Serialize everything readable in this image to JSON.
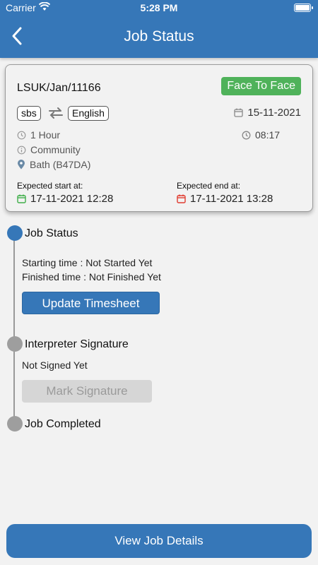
{
  "status_bar": {
    "carrier": "Carrier",
    "time": "5:28 PM"
  },
  "header": {
    "title": "Job Status"
  },
  "job": {
    "id": "LSUK/Jan/11166",
    "type_badge": "Face To Face",
    "source_language": "sbs",
    "target_language": "English",
    "date": "15-11-2021",
    "duration": "1 Hour",
    "time": "08:17",
    "category": "Community",
    "location": "Bath (B47DA)",
    "expected_start_label": "Expected start at:",
    "expected_start": "17-11-2021 12:28",
    "expected_end_label": "Expected end at:",
    "expected_end": "17-11-2021 13:28"
  },
  "timeline": {
    "step1_title": "Job Status",
    "starting_time": "Starting time : Not Started Yet",
    "finished_time": "Finished time : Not Finished Yet",
    "update_button": "Update Timesheet",
    "step2_title": "Interpreter Signature",
    "signature_status": "Not Signed Yet",
    "mark_button": "Mark Signature",
    "step3_title": "Job Completed"
  },
  "footer": {
    "view_button": "View Job Details"
  },
  "colors": {
    "primary": "#3677b8",
    "badge_green": "#4fb25a",
    "start_green": "#3fae49",
    "end_red": "#e03b2f"
  }
}
